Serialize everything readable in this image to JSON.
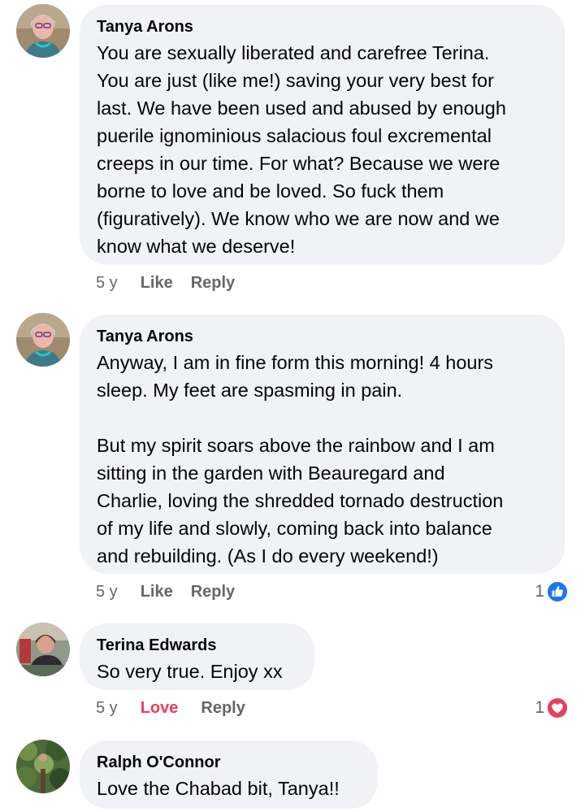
{
  "comments": [
    {
      "author": "Tanya Arons",
      "text": "You are sexually liberated and carefree Terina.\nYou are just (like me!) saving your very best for\nlast.  We have been used and abused by enough\npuerile ignominious salacious foul excremental\ncreeps in our time.  For what?  Because we were\nborne to love and be loved.  So fuck them\n(figuratively). We know who we are now and we\nknow what we deserve!",
      "time": "5 y",
      "reaction_label": "Like",
      "reply_label": "Reply"
    },
    {
      "author": "Tanya Arons",
      "text": "Anyway, I am in fine form this morning!  4 hours\nsleep.  My feet are spasming in pain.\n\nBut my spirit soars above the rainbow and I am\nsitting in the garden with Beauregard and\nCharlie, loving the shredded tornado destruction\nof my life and slowly, coming back into balance\nand rebuilding.  (As I do every weekend!)",
      "time": "5 y",
      "reaction_label": "Like",
      "reply_label": "Reply",
      "reaction_count": "1",
      "reaction_icon": "like-reaction-icon"
    },
    {
      "author": "Terina Edwards",
      "text": "So very true. Enjoy xx",
      "time": "5 y",
      "reaction_label": "Love",
      "reply_label": "Reply",
      "reaction_count": "1",
      "reaction_icon": "love-reaction-icon"
    },
    {
      "author": "Ralph O'Connor",
      "text": "Love the Chabad bit, Tanya!!"
    }
  ],
  "colors": {
    "bubble": "#f0f2f5",
    "meta_text": "#65676b",
    "like_blue": "#1877f2",
    "love_red": "#e4405f"
  }
}
